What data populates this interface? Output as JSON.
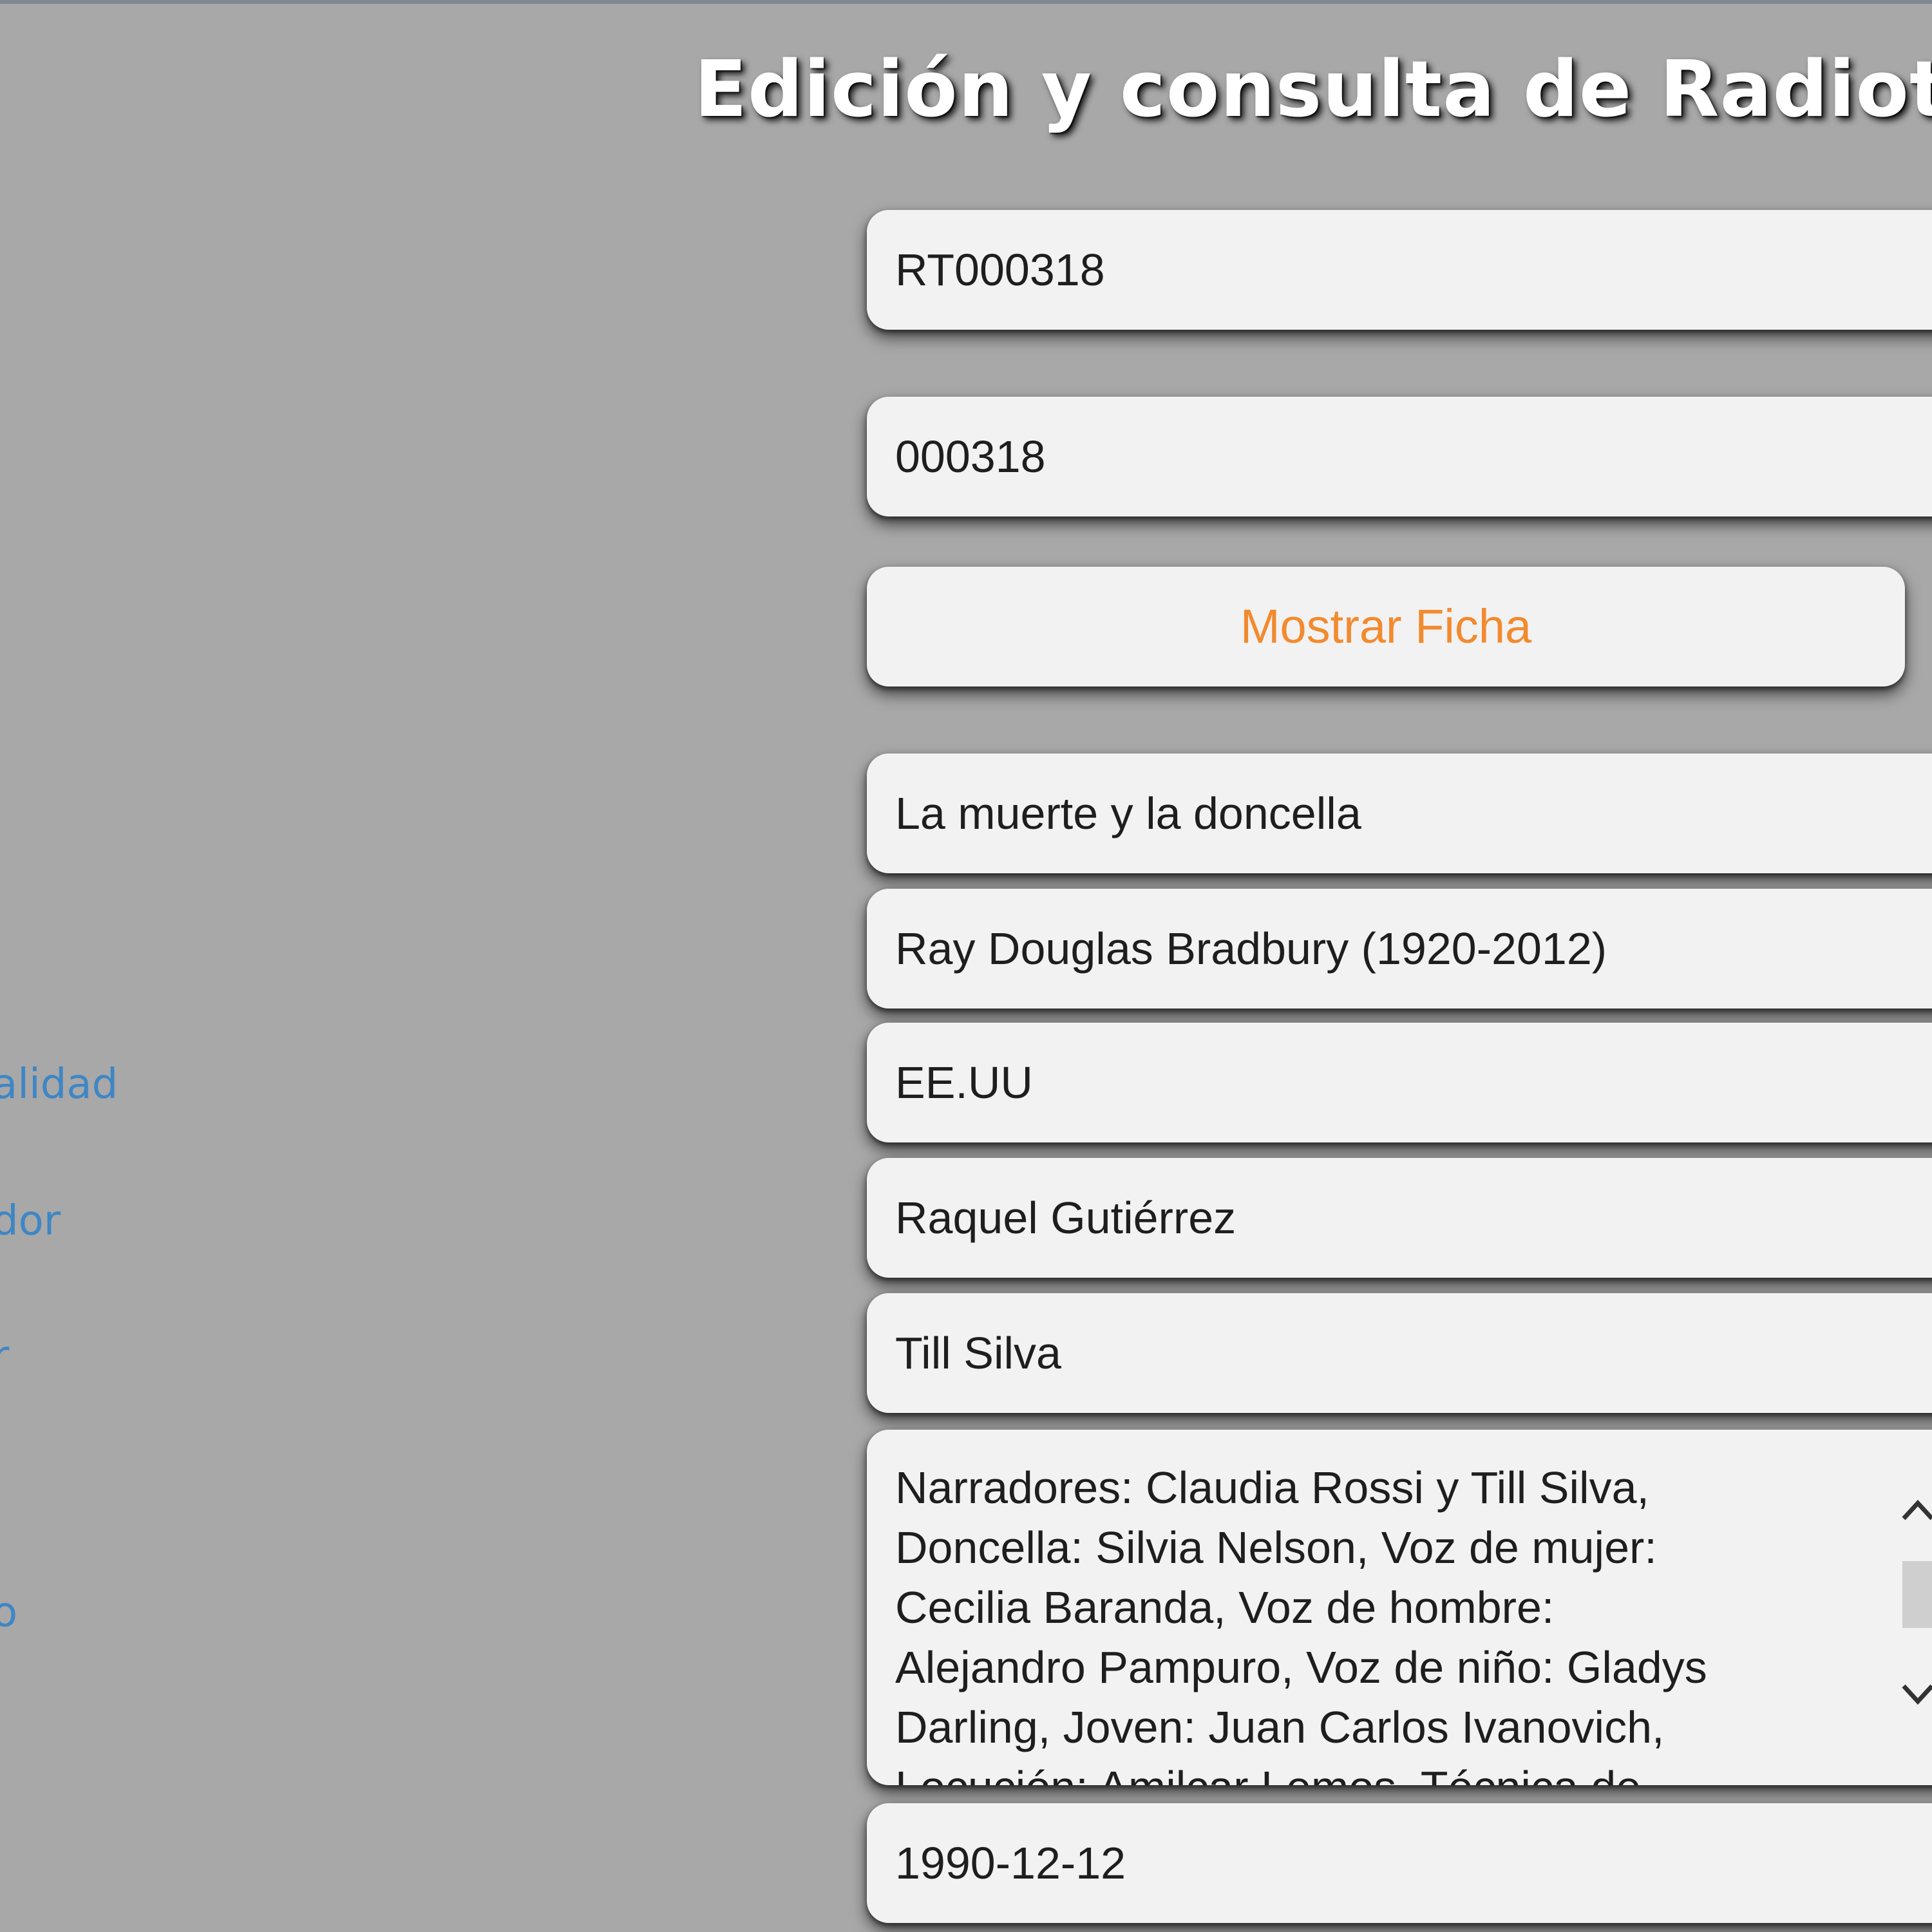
{
  "page": {
    "title": "Edición y consulta de Radiote"
  },
  "sidebar": {
    "labels": [
      "alidad",
      "dor",
      "r",
      "o"
    ]
  },
  "form": {
    "code": "RT000318",
    "number": "000318",
    "show_button_label": "Mostrar Ficha",
    "work_title": "La muerte y la doncella",
    "author": "Ray Douglas Bradbury (1920-2012)",
    "nationality": "EE.UU",
    "adapter": "Raquel Gutiérrez",
    "director": "Till Silva",
    "cast_lines": [
      "Narradores: Claudia Rossi y Till Silva,",
      "Doncella: Silvia Nelson, Voz de mujer:",
      "Cecilia Baranda, Voz de hombre:",
      "Alejandro Pampuro, Voz de niño: Gladys",
      "Darling, Joven: Juan Carlos Ivanovich,",
      "Locución: Amilcar Lemos, Técnica de"
    ],
    "date": "1990-12-12"
  },
  "colors": {
    "background": "#a8a8a8",
    "field": "#f2f2f2",
    "button_text": "#f28a2e",
    "label": "#3f86c4"
  },
  "icons": {
    "scroll_up": "chevron-up-icon",
    "scroll_down": "chevron-down-icon"
  }
}
